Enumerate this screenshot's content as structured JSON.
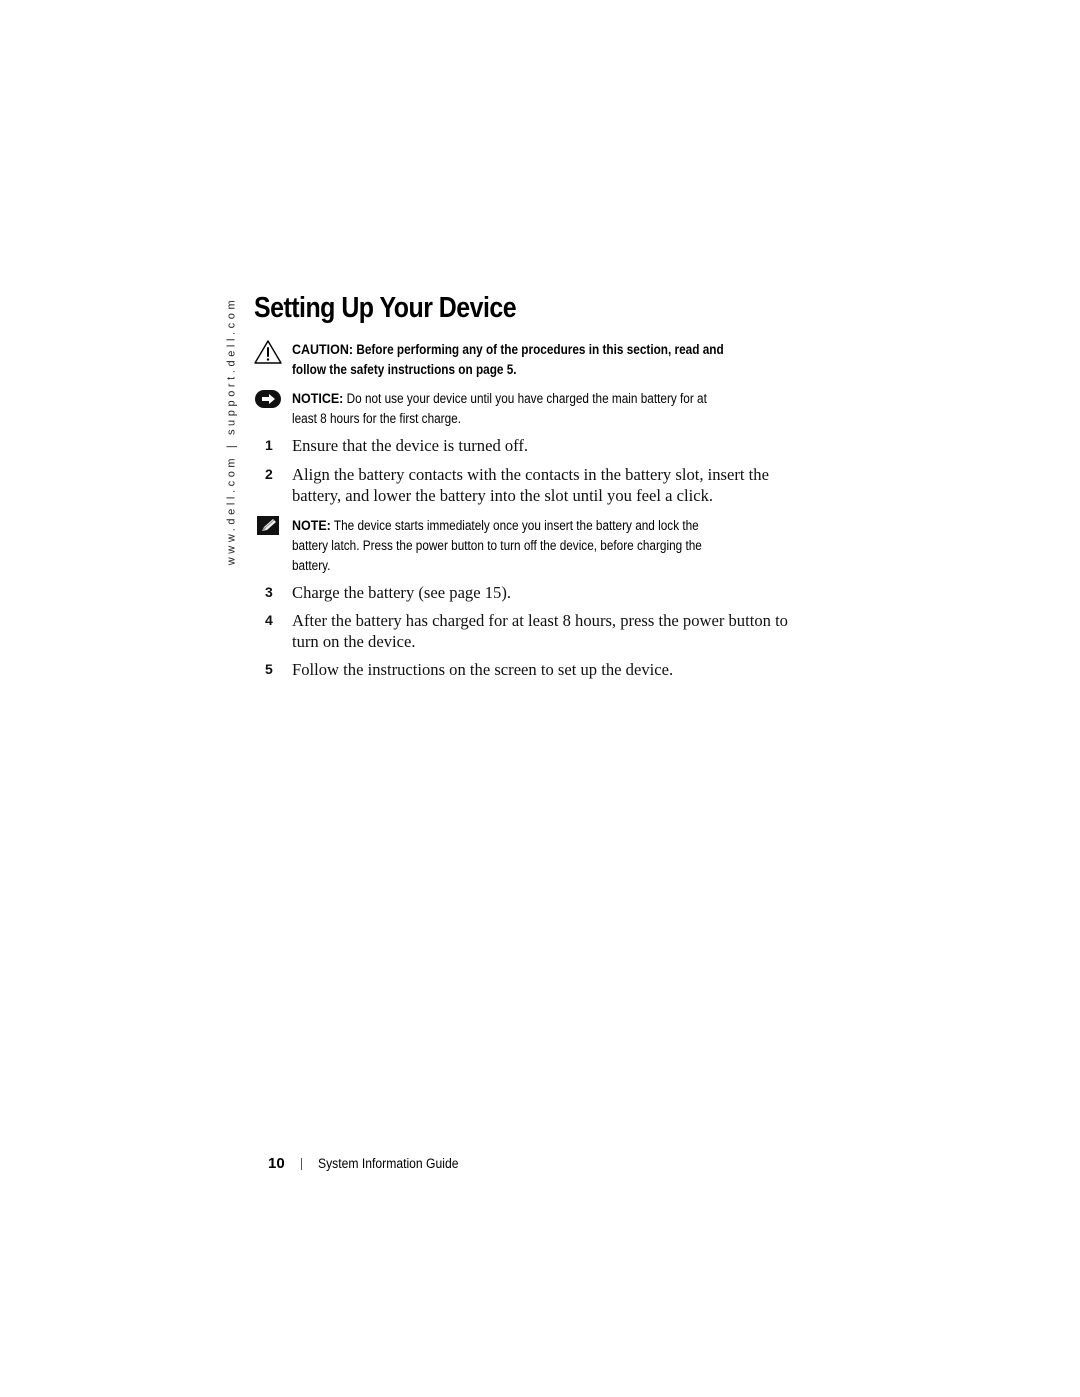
{
  "sidebar": {
    "url_text": "www.dell.com | support.dell.com"
  },
  "page": {
    "title": "Setting Up Your Device"
  },
  "caution": {
    "icon": "warning-triangle-icon",
    "label": "CAUTION:",
    "text": "Before performing any of the procedures in this section, read and follow the safety instructions on page 5."
  },
  "notice": {
    "icon": "notice-arrow-icon",
    "label": "NOTICE:",
    "text": "Do not use your device until you have charged the main battery for at least 8 hours for the first charge."
  },
  "note": {
    "icon": "pencil-note-icon",
    "label": "NOTE:",
    "text": "The device starts immediately once you insert the battery and lock the battery latch. Press the power button to turn off the device, before charging the battery."
  },
  "steps": [
    {
      "num": "1",
      "text": "Ensure that the device is turned off."
    },
    {
      "num": "2",
      "text": "Align the battery contacts with the contacts in the battery slot, insert the battery, and lower the battery into the slot until you feel a click."
    },
    {
      "num": "3",
      "text": "Charge the battery (see page 15)."
    },
    {
      "num": "4",
      "text": "After the battery has charged for at least 8 hours, press the power button to turn on the device."
    },
    {
      "num": "5",
      "text": "Follow the instructions on the screen to set up the device."
    }
  ],
  "footer": {
    "page_number": "10",
    "guide_title": "System Information Guide"
  }
}
